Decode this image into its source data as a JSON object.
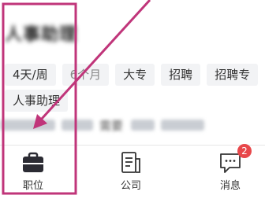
{
  "job": {
    "title_obscured": "人事助理",
    "tags": [
      "4天/周",
      "6个月",
      "大专",
      "招聘",
      "招聘专"
    ],
    "tag_row2": "人事助理",
    "obscured_line": "需要"
  },
  "tabbar": {
    "items": [
      {
        "label": "职位",
        "icon": "briefcase-icon"
      },
      {
        "label": "公司",
        "icon": "document-icon"
      },
      {
        "label": "消息",
        "icon": "chat-bubble-icon"
      }
    ],
    "message_badge": "2"
  },
  "annotation": {
    "color": "#c0357a"
  }
}
